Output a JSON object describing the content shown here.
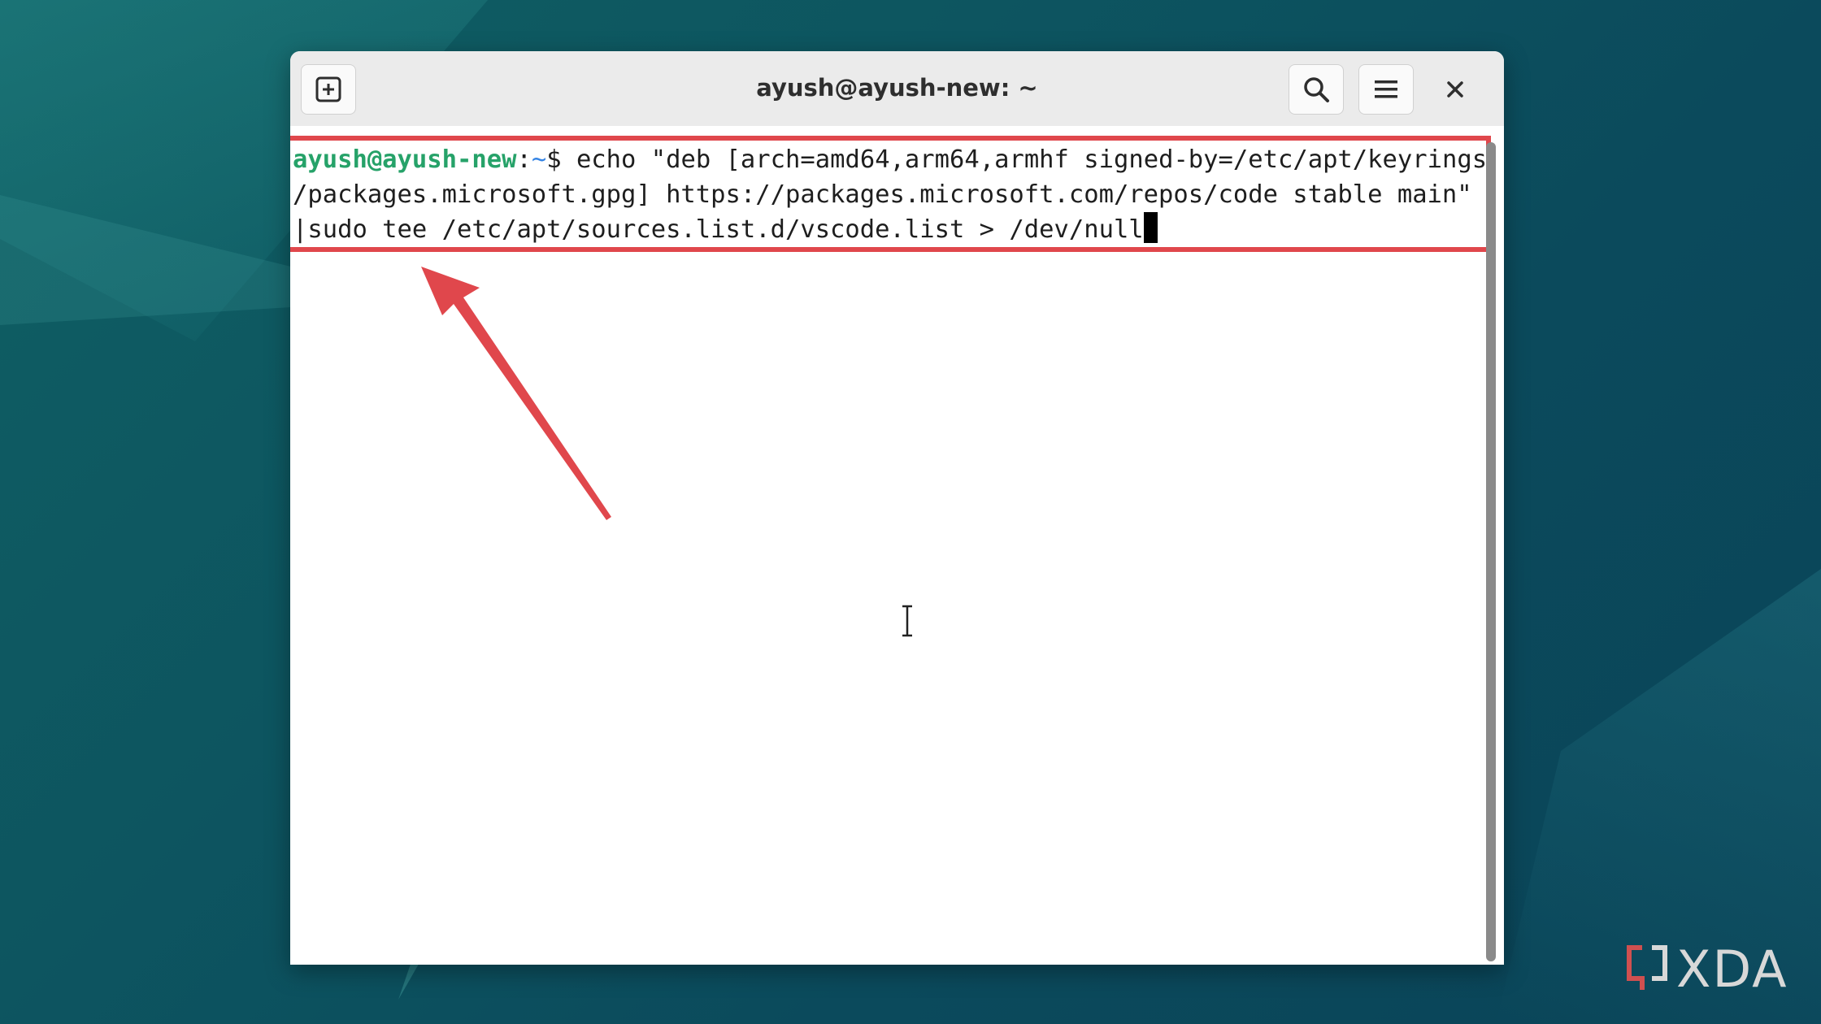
{
  "window": {
    "title": "ayush@ayush-new: ~"
  },
  "toolbar": {
    "new_tab_icon": "new-tab-icon",
    "search_icon": "search-icon",
    "menu_icon": "hamburger-menu-icon",
    "close_icon": "close-icon"
  },
  "terminal": {
    "prompt_user": "ayush@ayush-new",
    "prompt_sep": ":",
    "prompt_path": "~",
    "prompt_symbol": "$ ",
    "line1_cmd": "echo \"deb [arch=amd64,arm64,armhf signed-by=/etc/apt/keyrings",
    "line2": "/packages.microsoft.gpg] https://packages.microsoft.com/repos/code stable main\"",
    "line3": "|sudo tee /etc/apt/sources.list.d/vscode.list > /dev/null"
  },
  "annotation": {
    "highlight_color": "#e0474c",
    "arrow_color": "#e0474c"
  },
  "watermark": {
    "text": "XDA"
  }
}
